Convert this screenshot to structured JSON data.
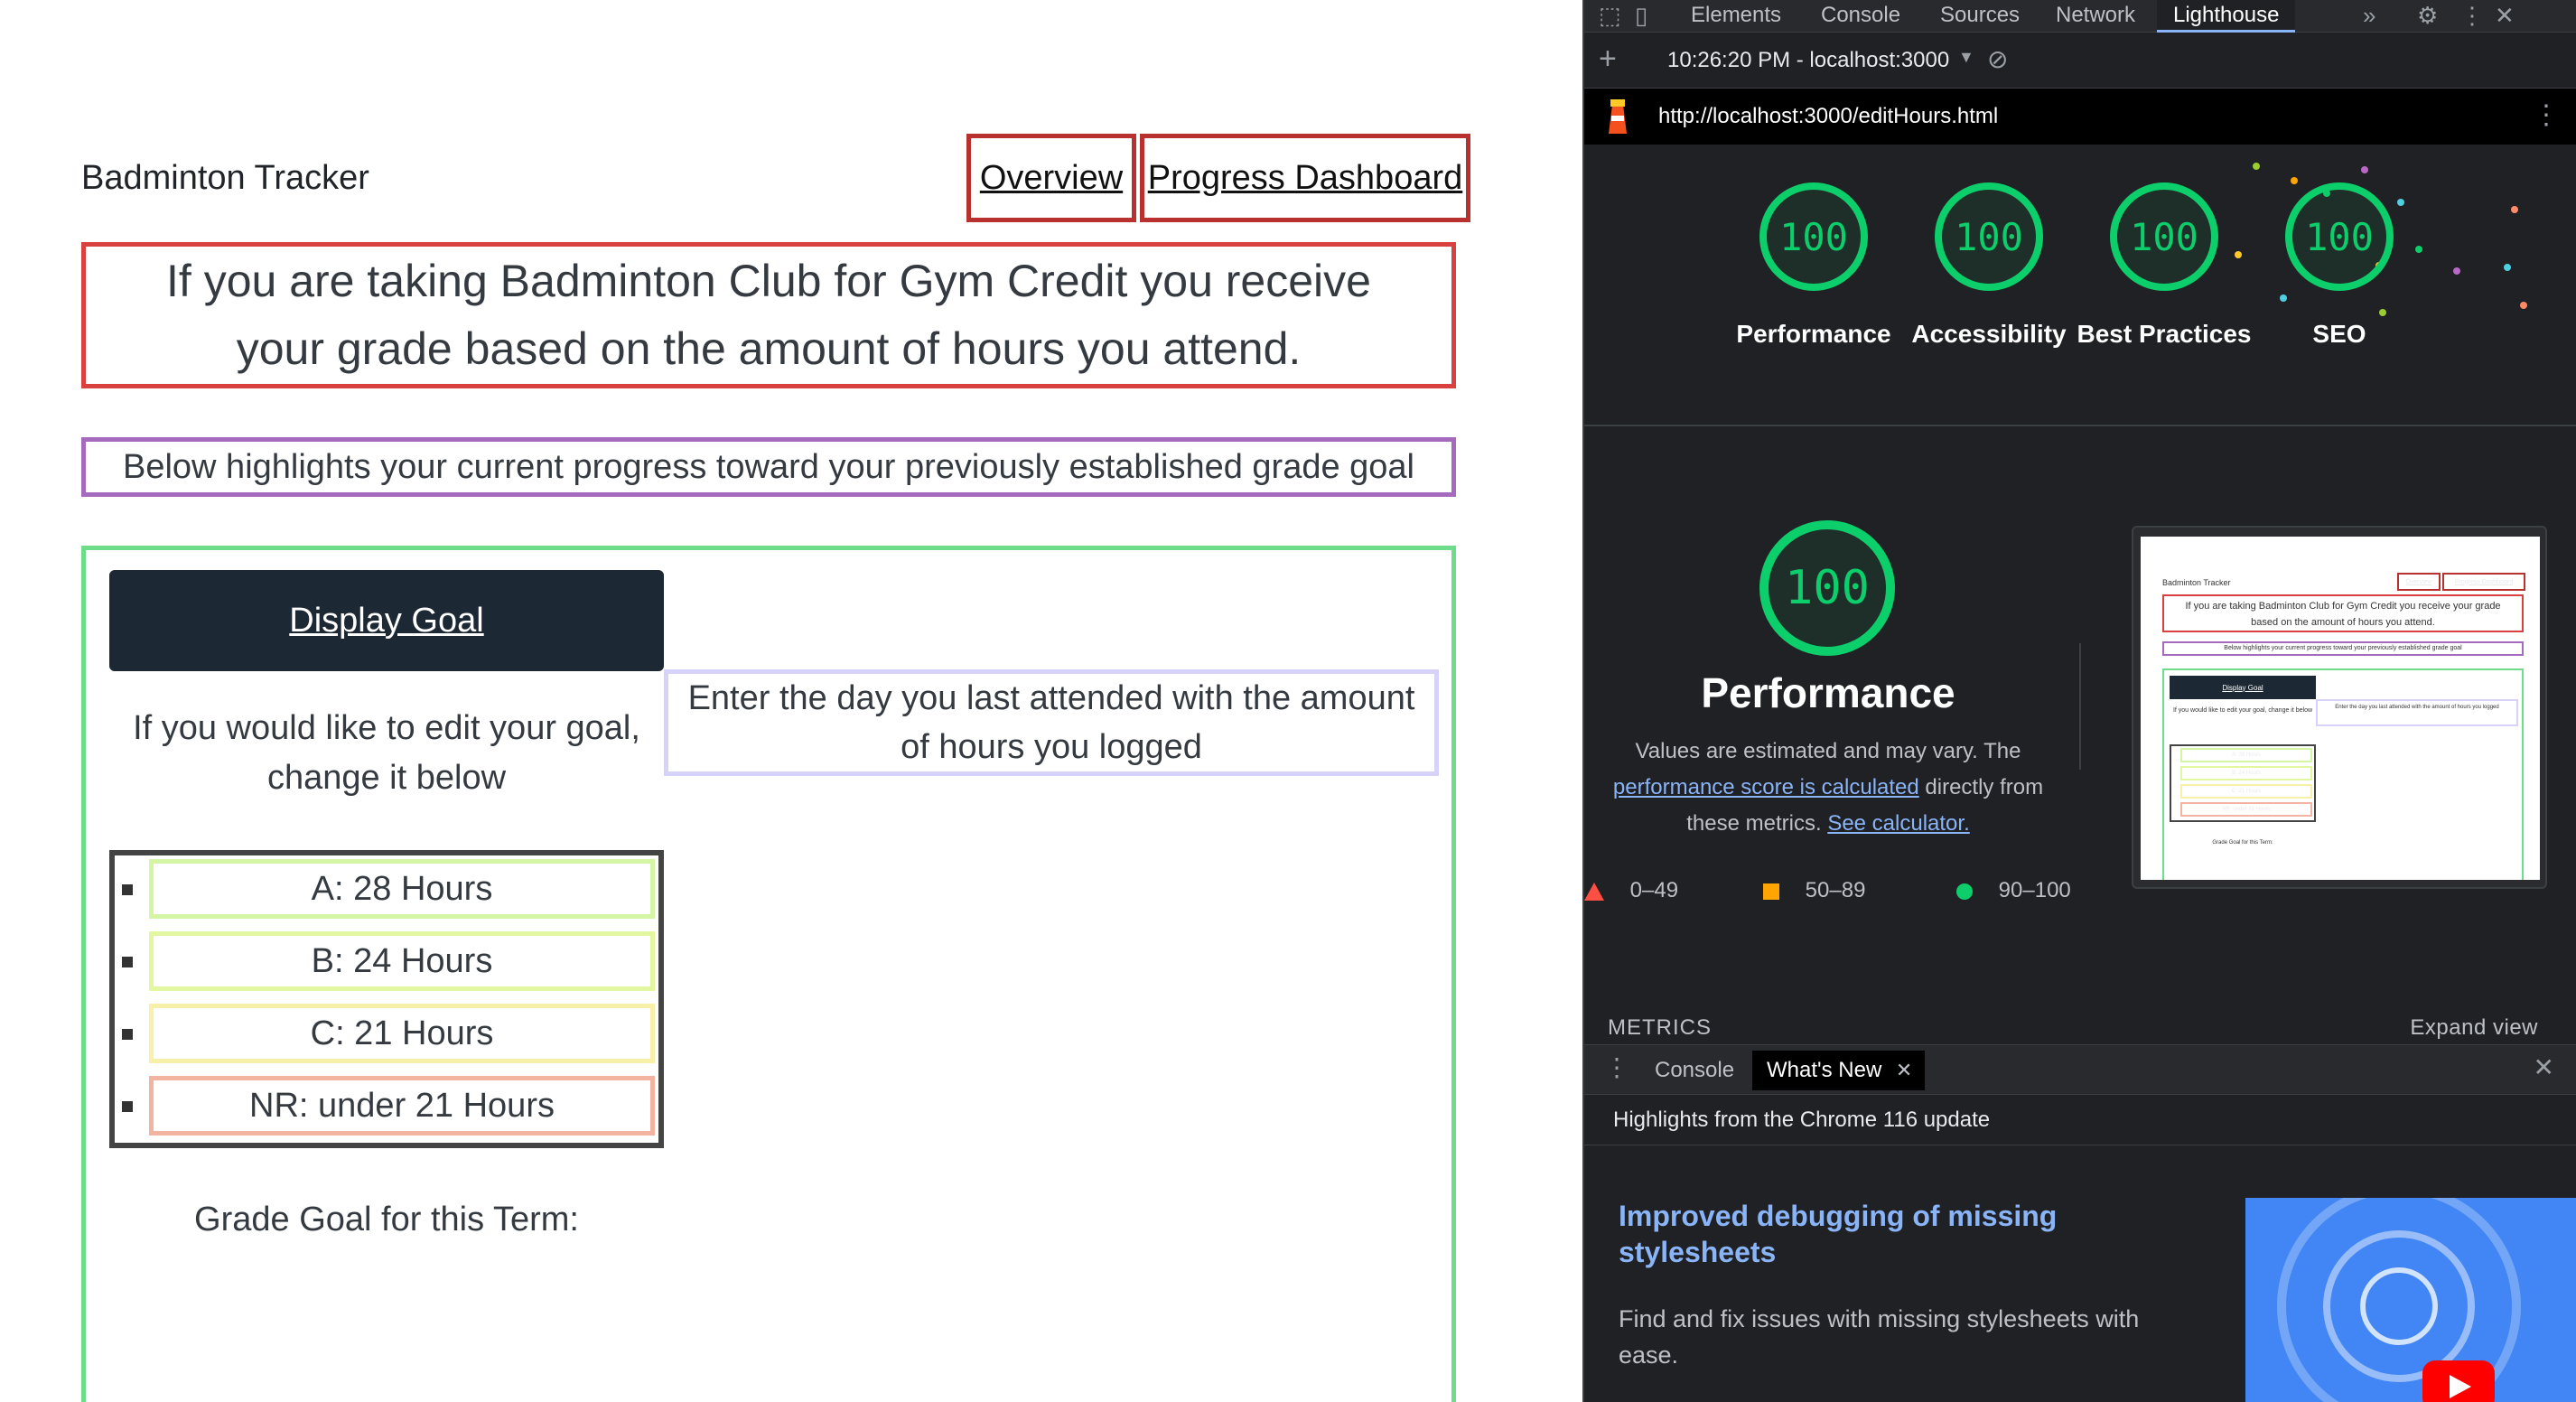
{
  "page": {
    "brand": "Badminton Tracker",
    "nav": {
      "overview": "Overview",
      "progress": "Progress Dashboard"
    },
    "intro": "If you are taking Badminton Club for Gym Credit you receive your grade based on the amount of hours you attend.",
    "progress_note": "Below highlights your current progress toward your previously established grade goal",
    "display_goal": "Display Goal",
    "edit_goal": "If you would like to edit your goal, change it below",
    "enter_day": "Enter the day you last attended with the amount of hours you logged",
    "grades": [
      {
        "label": "A: 28 Hours",
        "color": "#d4f5a3"
      },
      {
        "label": "B: 24 Hours",
        "color": "#e3f7a0"
      },
      {
        "label": "C: 21 Hours",
        "color": "#f8f0a8"
      },
      {
        "label": "NR: under 21 Hours",
        "color": "#f2b3a0"
      }
    ],
    "goal_label": "Grade Goal for this Term:"
  },
  "devtools": {
    "tabs": [
      "Elements",
      "Console",
      "Sources",
      "Network",
      "Lighthouse"
    ],
    "active_tab": "Lighthouse",
    "report_time": "10:26:20 PM - localhost:3000",
    "url": "http://localhost:3000/editHours.html",
    "scores": [
      {
        "value": "100",
        "label": "Performance"
      },
      {
        "value": "100",
        "label": "Accessibility"
      },
      {
        "value": "100",
        "label": "Best Practices"
      },
      {
        "value": "100",
        "label": "SEO"
      }
    ],
    "performance": {
      "score": "100",
      "title": "Performance",
      "desc_1": "Values are estimated and may vary. The",
      "link_1": "performance score is calculated",
      "desc_2": "directly from these metrics.",
      "link_2": "See calculator."
    },
    "legend": [
      "0–49",
      "50–89",
      "90–100"
    ],
    "metrics_label": "METRICS",
    "expand_view": "Expand view",
    "drawer_tabs": [
      "Console",
      "What's New"
    ],
    "highlights": "Highlights from the Chrome 116 update",
    "news_title": "Improved debugging of missing stylesheets",
    "news_desc": "Find and fix issues with missing stylesheets with ease.",
    "colors": {
      "pass": "#0cce6b",
      "average": "#ffa400",
      "fail": "#ff4e42",
      "link": "#8ab4f8"
    }
  }
}
